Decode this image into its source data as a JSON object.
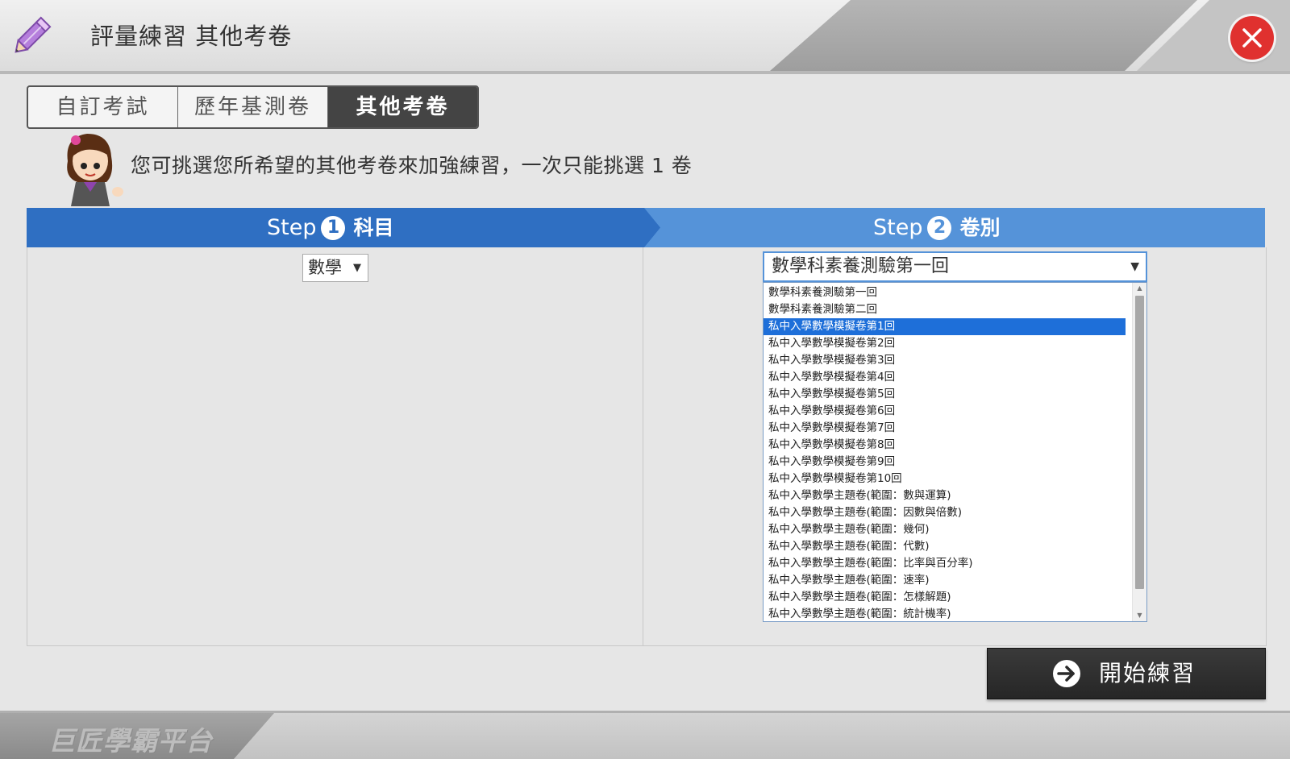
{
  "header": {
    "title": "評量練習 其他考卷",
    "icon": "pencil-icon",
    "close_icon": "close-icon",
    "close_color": "#e0312f"
  },
  "tabs": [
    {
      "label": "自訂考試",
      "active": false
    },
    {
      "label": "歷年基測卷",
      "active": false
    },
    {
      "label": "其他考卷",
      "active": true
    }
  ],
  "instruction": "您可挑選您所希望的其他考卷來加強練習，一次只能挑選 1 卷",
  "steps": [
    {
      "prefix": "Step",
      "number": "1",
      "label": "科目",
      "color": "#2f6fc2"
    },
    {
      "prefix": "Step",
      "number": "2",
      "label": "卷別",
      "color": "#5593d9"
    }
  ],
  "subject_select": {
    "value": "數學"
  },
  "paper_select": {
    "value": "數學科素養測驗第一回",
    "options": [
      "數學科素養測驗第一回",
      "數學科素養測驗第二回",
      "私中入學數學模擬卷第1回",
      "私中入學數學模擬卷第2回",
      "私中入學數學模擬卷第3回",
      "私中入學數學模擬卷第4回",
      "私中入學數學模擬卷第5回",
      "私中入學數學模擬卷第6回",
      "私中入學數學模擬卷第7回",
      "私中入學數學模擬卷第8回",
      "私中入學數學模擬卷第9回",
      "私中入學數學模擬卷第10回",
      "私中入學數學主題卷(範圍：數與運算)",
      "私中入學數學主題卷(範圍：因數與倍數)",
      "私中入學數學主題卷(範圍：幾何)",
      "私中入學數學主題卷(範圍：代數)",
      "私中入學數學主題卷(範圍：比率與百分率)",
      "私中入學數學主題卷(範圍：速率)",
      "私中入學數學主題卷(範圍：怎樣解題)",
      "私中入學數學主題卷(範圍：統計機率)"
    ],
    "highlighted_index": 2
  },
  "start_button": {
    "label": "開始練習",
    "icon": "arrow-right-circle-icon"
  },
  "footer": {
    "brand": "巨匠學霸平台"
  }
}
